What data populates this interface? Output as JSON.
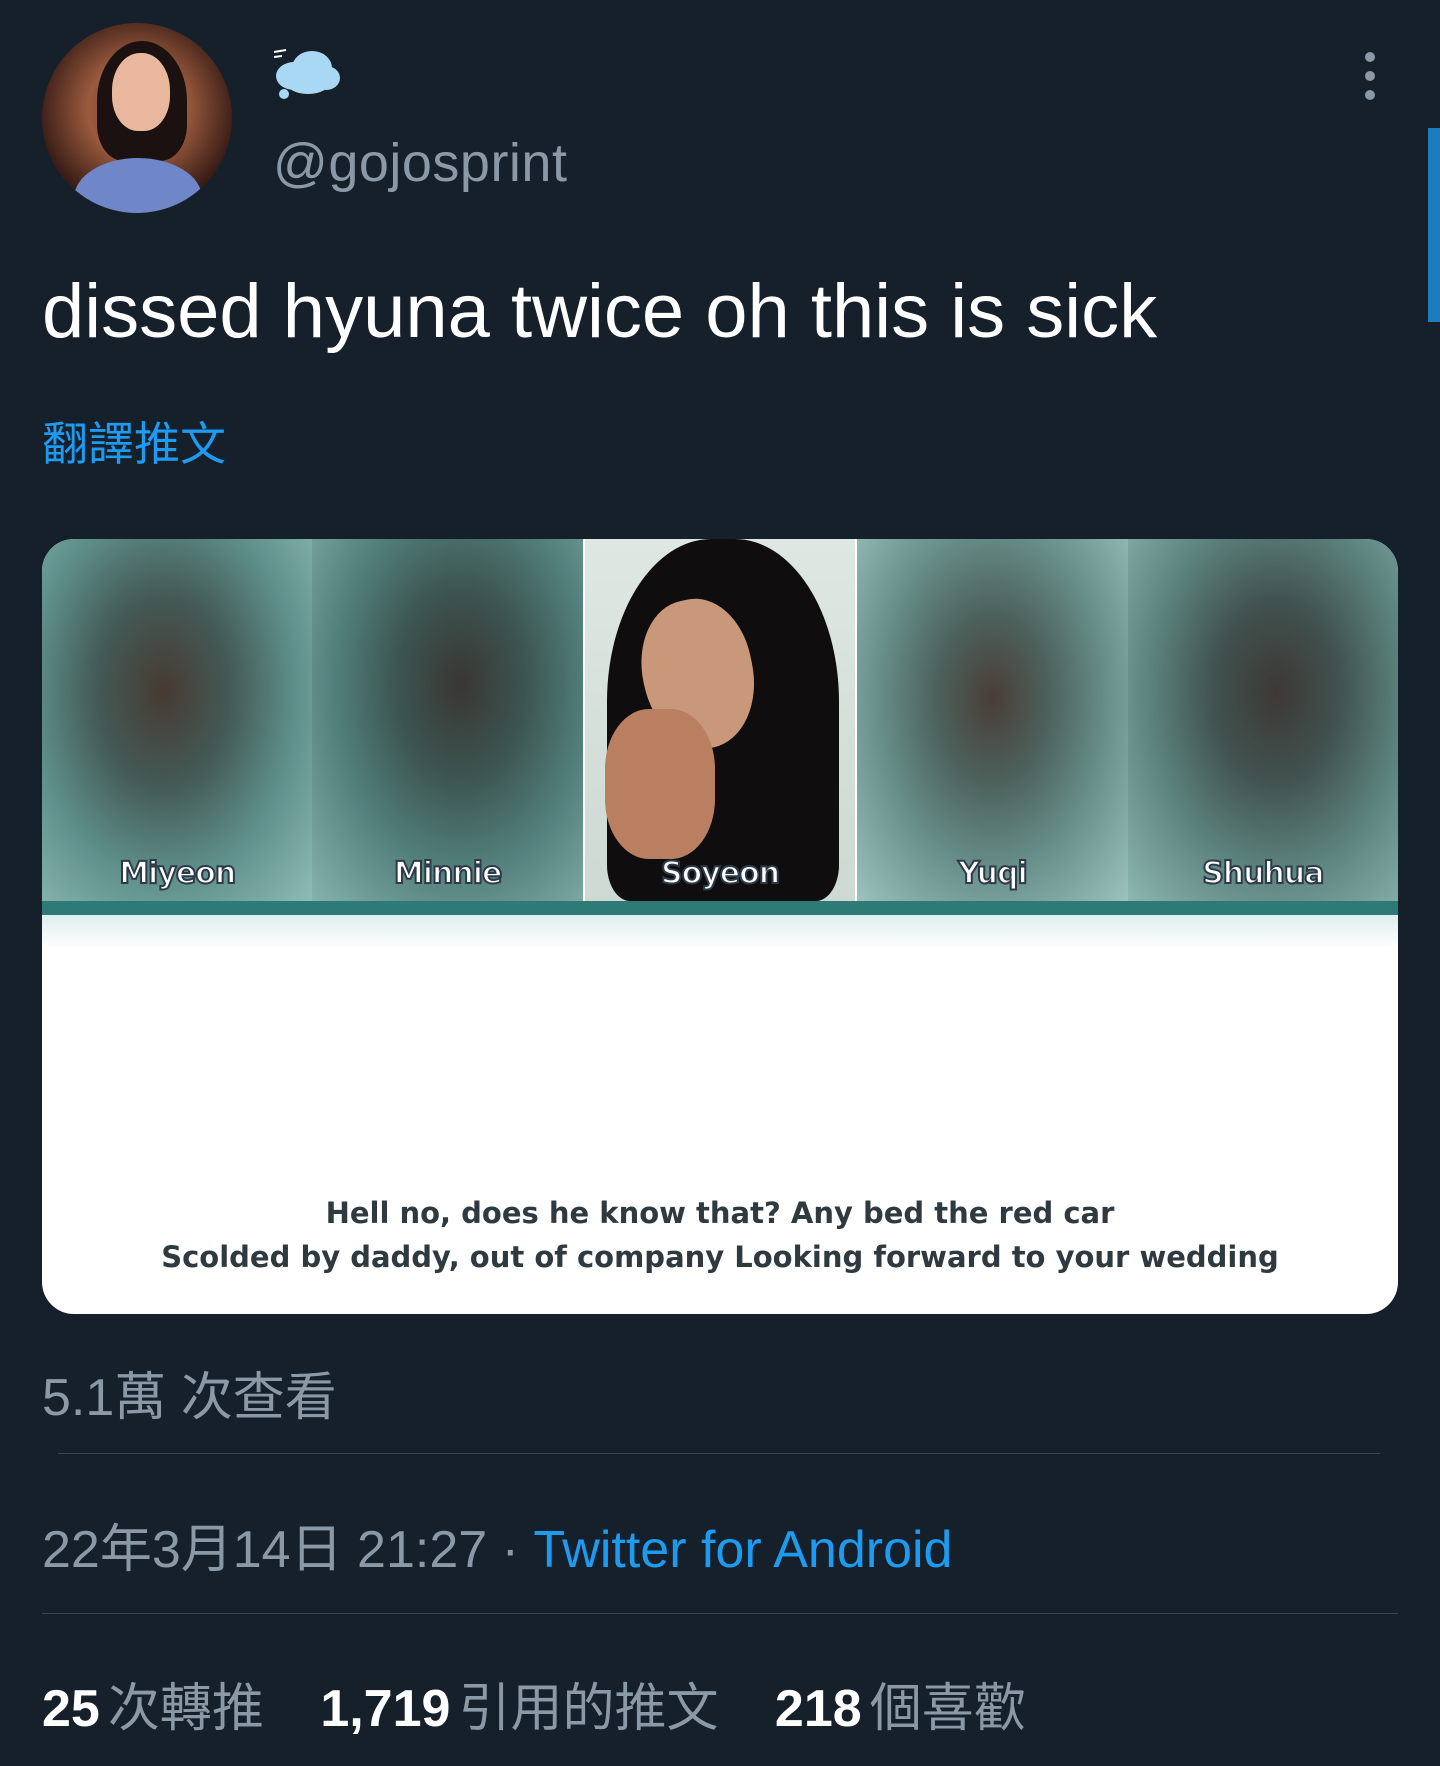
{
  "author": {
    "handle": "@gojosprint"
  },
  "tweet": {
    "text": "dissed hyuna twice oh this is sick",
    "translate_label": "翻譯推文"
  },
  "media": {
    "members": [
      "Miyeon",
      "Minnie",
      "Soyeon",
      "Yuqi",
      "Shuhua"
    ],
    "subtitle_line1": "Hell no, does he know that? Any bed the red car",
    "subtitle_line2": "Scolded by daddy, out of company Looking forward to your wedding"
  },
  "meta": {
    "views": "5.1萬 次查看",
    "timestamp": "22年3月14日 21:27",
    "separator": " · ",
    "source": "Twitter for Android"
  },
  "stats": {
    "retweets_count": "25",
    "retweets_label": "次轉推",
    "quotes_count": "1,719",
    "quotes_label": "引用的推文",
    "likes_count": "218",
    "likes_label": "個喜歡"
  },
  "colors": {
    "background": "#15202b",
    "accent": "#1d9bf0",
    "muted_text": "#8b98a5",
    "teal": "#2e7a77"
  },
  "icons": {
    "avatar": "avatar-photo",
    "status_emoji": "cloud-icon",
    "menu": "more-vertical-icon"
  }
}
